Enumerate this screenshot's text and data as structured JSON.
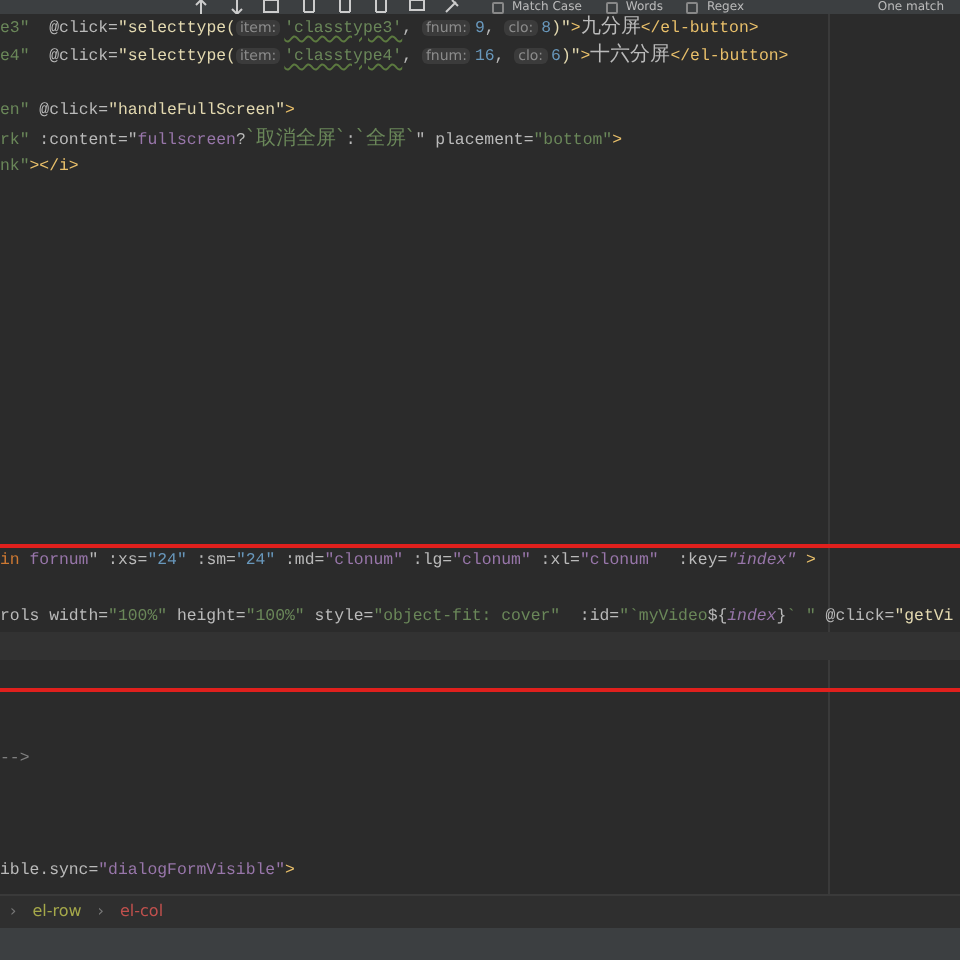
{
  "find_bar": {
    "options": [
      {
        "label": "Match Case",
        "checked": false
      },
      {
        "label": "Words",
        "checked": false
      },
      {
        "label": "Regex",
        "checked": false
      }
    ],
    "result": "One match"
  },
  "editor": {
    "lines": [
      {
        "kind": "code",
        "tokens": [
          {
            "kind": "str",
            "t": "e3\""
          },
          {
            "kind": "plain",
            "t": "  @click="
          },
          {
            "kind": "fn",
            "t": "\"selecttype("
          },
          {
            "kind": "hint",
            "t": "item:"
          },
          {
            "kind": "typo",
            "t": "'classtype3'"
          },
          {
            "kind": "plain",
            "t": ", "
          },
          {
            "kind": "hint",
            "t": "fnum:"
          },
          {
            "kind": "num",
            "t": "9"
          },
          {
            "kind": "plain",
            "t": ", "
          },
          {
            "kind": "hint",
            "t": "clo:"
          },
          {
            "kind": "num",
            "t": "8"
          },
          {
            "kind": "fn",
            "t": ")\""
          },
          {
            "kind": "tag",
            "t": ">"
          },
          {
            "kind": "cjk",
            "t": "九分屏"
          },
          {
            "kind": "tag",
            "t": "</el-button>"
          }
        ]
      },
      {
        "kind": "code",
        "tokens": [
          {
            "kind": "str",
            "t": "e4\""
          },
          {
            "kind": "plain",
            "t": "  @click="
          },
          {
            "kind": "fn",
            "t": "\"selecttype("
          },
          {
            "kind": "hint",
            "t": "item:"
          },
          {
            "kind": "typo",
            "t": "'classtype4'"
          },
          {
            "kind": "plain",
            "t": ", "
          },
          {
            "kind": "hint",
            "t": "fnum:"
          },
          {
            "kind": "num",
            "t": "16"
          },
          {
            "kind": "plain",
            "t": ", "
          },
          {
            "kind": "hint",
            "t": "clo:"
          },
          {
            "kind": "num",
            "t": "6"
          },
          {
            "kind": "fn",
            "t": ")\""
          },
          {
            "kind": "tag",
            "t": ">"
          },
          {
            "kind": "cjk",
            "t": "十六分屏"
          },
          {
            "kind": "tag",
            "t": "</el-button>"
          }
        ]
      },
      {
        "kind": "blank"
      },
      {
        "kind": "code",
        "tokens": [
          {
            "kind": "str",
            "t": "en\""
          },
          {
            "kind": "plain",
            "t": " @click="
          },
          {
            "kind": "fn",
            "t": "\"handleFullScreen\""
          },
          {
            "kind": "tag",
            "t": ">"
          }
        ]
      },
      {
        "kind": "code",
        "tokens": [
          {
            "kind": "str",
            "t": "rk\""
          },
          {
            "kind": "plain",
            "t": " :content=\""
          },
          {
            "kind": "var",
            "t": "fullscreen"
          },
          {
            "kind": "plain",
            "t": "?"
          },
          {
            "kind": "cjkstr",
            "t": "`取消全屏`"
          },
          {
            "kind": "plain",
            "t": ":"
          },
          {
            "kind": "cjkstr",
            "t": "`全屏`"
          },
          {
            "kind": "plain",
            "t": "\" placement="
          },
          {
            "kind": "str",
            "t": "\"bottom\""
          },
          {
            "kind": "tag",
            "t": ">"
          }
        ]
      },
      {
        "kind": "code",
        "tokens": [
          {
            "kind": "str",
            "t": "nk\""
          },
          {
            "kind": "tag",
            "t": "></i>"
          }
        ]
      },
      {
        "kind": "blank"
      },
      {
        "kind": "blank"
      },
      {
        "kind": "blank"
      },
      {
        "kind": "blank"
      },
      {
        "kind": "blank"
      },
      {
        "kind": "blank"
      },
      {
        "kind": "blank"
      },
      {
        "kind": "blank"
      },
      {
        "kind": "blank"
      },
      {
        "kind": "blank"
      },
      {
        "kind": "blank"
      },
      {
        "kind": "blank"
      },
      {
        "kind": "blank"
      },
      {
        "kind": "box",
        "lines": [
          {
            "kind": "code",
            "tokens": [
              {
                "kind": "kw",
                "t": "in"
              },
              {
                "kind": "var",
                "t": " fornum"
              },
              {
                "kind": "plain",
                "t": "\" :xs="
              },
              {
                "kind": "num",
                "t": "\"24\""
              },
              {
                "kind": "plain",
                "t": " :sm="
              },
              {
                "kind": "num",
                "t": "\"24\""
              },
              {
                "kind": "plain",
                "t": " :md="
              },
              {
                "kind": "var",
                "t": "\"clonum\""
              },
              {
                "kind": "plain",
                "t": " :lg="
              },
              {
                "kind": "var",
                "t": "\"clonum\""
              },
              {
                "kind": "plain",
                "t": " :xl="
              },
              {
                "kind": "var",
                "t": "\"clonum\""
              },
              {
                "kind": "plain",
                "t": "  :key="
              },
              {
                "kind": "ivar",
                "t": "\"index\""
              },
              {
                "kind": "tag",
                "t": " >"
              }
            ]
          },
          {
            "kind": "blank"
          },
          {
            "kind": "code",
            "tokens": [
              {
                "kind": "plain",
                "t": "rols width="
              },
              {
                "kind": "str",
                "t": "\"100%\""
              },
              {
                "kind": "plain",
                "t": " height="
              },
              {
                "kind": "str",
                "t": "\"100%\""
              },
              {
                "kind": "plain",
                "t": " style="
              },
              {
                "kind": "str",
                "t": "\"object-fit: cover\""
              },
              {
                "kind": "plain",
                "t": "  :id="
              },
              {
                "kind": "str",
                "t": "\"`myVideo"
              },
              {
                "kind": "plain",
                "t": "${"
              },
              {
                "kind": "ivar",
                "t": "index"
              },
              {
                "kind": "plain",
                "t": "}"
              },
              {
                "kind": "str",
                "t": "` \""
              },
              {
                "kind": "plain",
                "t": " @click="
              },
              {
                "kind": "fn",
                "t": "\"getVi"
              }
            ]
          },
          {
            "kind": "caret_line"
          },
          {
            "kind": "blank"
          }
        ]
      },
      {
        "kind": "blank"
      },
      {
        "kind": "blank"
      },
      {
        "kind": "code",
        "tokens": [
          {
            "kind": "comment",
            "t": "-->"
          }
        ]
      },
      {
        "kind": "blank"
      },
      {
        "kind": "blank"
      },
      {
        "kind": "blank"
      },
      {
        "kind": "code",
        "tokens": [
          {
            "kind": "plain",
            "t": "ible.sync="
          },
          {
            "kind": "var",
            "t": "\"dialogFormVisible\""
          },
          {
            "kind": "tag",
            "t": ">"
          }
        ]
      }
    ]
  },
  "breadcrumb": [
    {
      "separator": "›",
      "label": "el-row",
      "color": "#a5a84a"
    },
    {
      "separator": "›",
      "label": "el-col",
      "color": "#c0504d"
    }
  ]
}
